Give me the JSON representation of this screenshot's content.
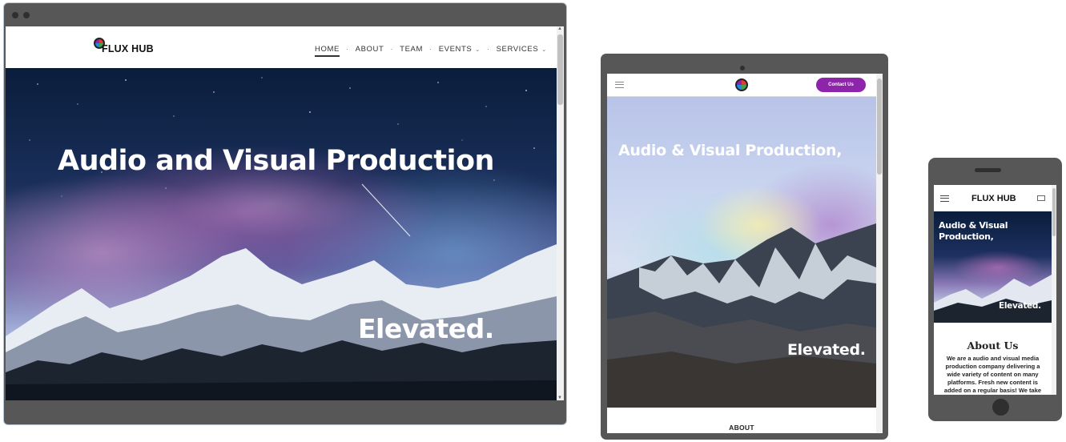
{
  "desktop": {
    "brand": "FLUX HUB",
    "nav": [
      {
        "label": "HOME",
        "active": true,
        "dropdown": false
      },
      {
        "label": "ABOUT",
        "active": false,
        "dropdown": false
      },
      {
        "label": "TEAM",
        "active": false,
        "dropdown": false
      },
      {
        "label": "EVENTS",
        "active": false,
        "dropdown": true
      },
      {
        "label": "SERVICES",
        "active": false,
        "dropdown": true
      }
    ],
    "hero_title": "Audio and Visual Production",
    "hero_sub": "Elevated."
  },
  "tablet": {
    "contact_label": "Contact Us",
    "hero_title": "Audio & Visual Production,",
    "hero_sub": "Elevated.",
    "section_label": "ABOUT"
  },
  "phone": {
    "brand": "FLUX HUB",
    "hero_title_line1": "Audio & Visual",
    "hero_title_line2": "Production,",
    "hero_sub": "Elevated.",
    "about_title": "About Us",
    "about_text": "We are a audio and visual media production company delivering a wide variety of content on many platforms. Fresh new content is added on a regular basis! We take"
  },
  "colors": {
    "device_frame": "#575757",
    "accent_purple": "#8e24aa",
    "text_dark": "#111111"
  },
  "icons": {
    "logo": "flux-hub-logo-icon",
    "menu": "hamburger-menu-icon",
    "mail": "mail-icon",
    "chevron": "chevron-down-icon"
  }
}
